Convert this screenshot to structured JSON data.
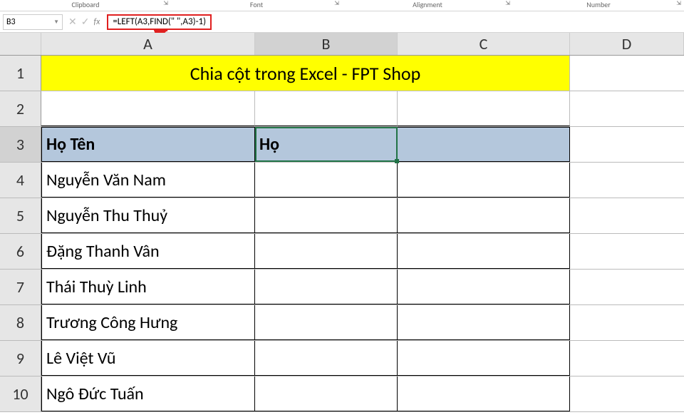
{
  "ribbon": {
    "clipboard": "Clipboard",
    "font": "Font",
    "alignment": "Alignment",
    "number": "Number"
  },
  "namebox": {
    "cell": "B3"
  },
  "formula": "=LEFT(A3,FIND(\" \",A3)-1)",
  "columns": {
    "A": "A",
    "B": "B",
    "C": "C",
    "D": "D"
  },
  "rows": {
    "r1": "1",
    "r2": "2",
    "r3": "3",
    "r4": "4",
    "r5": "5",
    "r6": "6",
    "r7": "7",
    "r8": "8",
    "r9": "9",
    "r10": "10"
  },
  "title_merged": "Chia cột trong Excel - FPT Shop",
  "headers": {
    "a": "Họ Tên",
    "b": "Họ"
  },
  "data": [
    "Nguyễn Văn Nam",
    "Nguyễn Thu Thuỷ",
    "Đặng Thanh Vân",
    "Thái Thuỳ Linh",
    "Trương Công Hưng",
    "Lê Việt Vũ",
    "Ngô Đức Tuấn"
  ]
}
